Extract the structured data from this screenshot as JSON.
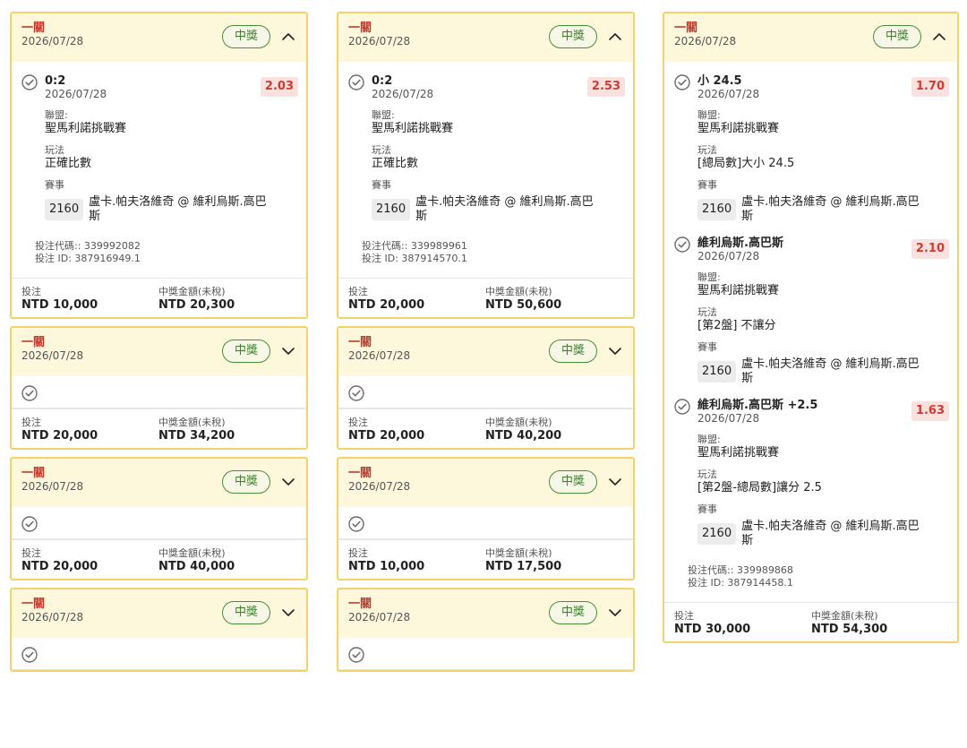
{
  "labels": {
    "parlay_title": "一關",
    "won_badge": "中獎",
    "league": "聯盟:",
    "market": "玩法",
    "event": "賽事",
    "bet_code": "投注代碼::",
    "bet_id": "投注 ID:",
    "stake": "投注",
    "payout": "中獎金額(未稅)"
  },
  "columns": [
    {
      "cards": [
        {
          "date": "2026/07/28",
          "expanded": true,
          "bets": [
            {
              "selection": "0:2",
              "date": "2026/07/28",
              "odds": "2.03",
              "league": "聖馬利諾挑戰賽",
              "market": "正確比數",
              "event_no": "2160",
              "event_name": "盧卡.帕夫洛維奇 @ 維利烏斯.高巴斯"
            }
          ],
          "code": "339992082",
          "id": "387916949.1",
          "stake": "NTD 10,000",
          "payout": "NTD 20,300"
        },
        {
          "date": "2026/07/28",
          "expanded": false,
          "stake": "NTD 20,000",
          "payout": "NTD 34,200"
        },
        {
          "date": "2026/07/28",
          "expanded": false,
          "stake": "NTD 20,000",
          "payout": "NTD 40,000"
        },
        {
          "date": "2026/07/28",
          "expanded": false
        }
      ]
    },
    {
      "cards": [
        {
          "date": "2026/07/28",
          "expanded": true,
          "bets": [
            {
              "selection": "0:2",
              "date": "2026/07/28",
              "odds": "2.53",
              "league": "聖馬利諾挑戰賽",
              "market": "正確比數",
              "event_no": "2160",
              "event_name": "盧卡.帕夫洛維奇 @ 維利烏斯.高巴斯"
            }
          ],
          "code": "339989961",
          "id": "387914570.1",
          "stake": "NTD 20,000",
          "payout": "NTD 50,600"
        },
        {
          "date": "2026/07/28",
          "expanded": false,
          "stake": "NTD 20,000",
          "payout": "NTD 40,200"
        },
        {
          "date": "2026/07/28",
          "expanded": false,
          "stake": "NTD 10,000",
          "payout": "NTD 17,500"
        },
        {
          "date": "2026/07/28",
          "expanded": false
        }
      ]
    },
    {
      "cards": [
        {
          "date": "2026/07/28",
          "expanded": true,
          "bets": [
            {
              "selection": "小 24.5",
              "date": "2026/07/28",
              "odds": "1.70",
              "league": "聖馬利諾挑戰賽",
              "market": "[總局數]大小 24.5",
              "event_no": "2160",
              "event_name": "盧卡.帕夫洛維奇 @ 維利烏斯.高巴斯"
            },
            {
              "selection": "維利烏斯.高巴斯",
              "date": "2026/07/28",
              "odds": "2.10",
              "league": "聖馬利諾挑戰賽",
              "market": "[第2盤] 不讓分",
              "event_no": "2160",
              "event_name": "盧卡.帕夫洛維奇 @ 維利烏斯.高巴斯"
            },
            {
              "selection": "維利烏斯.高巴斯 +2.5",
              "date": "2026/07/28",
              "odds": "1.63",
              "league": "聖馬利諾挑戰賽",
              "market": "[第2盤-總局數]讓分 2.5",
              "event_no": "2160",
              "event_name": "盧卡.帕夫洛維奇 @ 維利烏斯.高巴斯"
            }
          ],
          "code": "339989868",
          "id": "387914458.1",
          "stake": "NTD 30,000",
          "payout": "NTD 54,300"
        }
      ]
    }
  ],
  "colors": {
    "accent_border": "#f2d36b",
    "header_bg": "#fdf7dc",
    "title_red": "#c0392b",
    "won_green": "#3a7f28",
    "odds_bg": "#f9e1df",
    "odds_text": "#d33a2f"
  }
}
